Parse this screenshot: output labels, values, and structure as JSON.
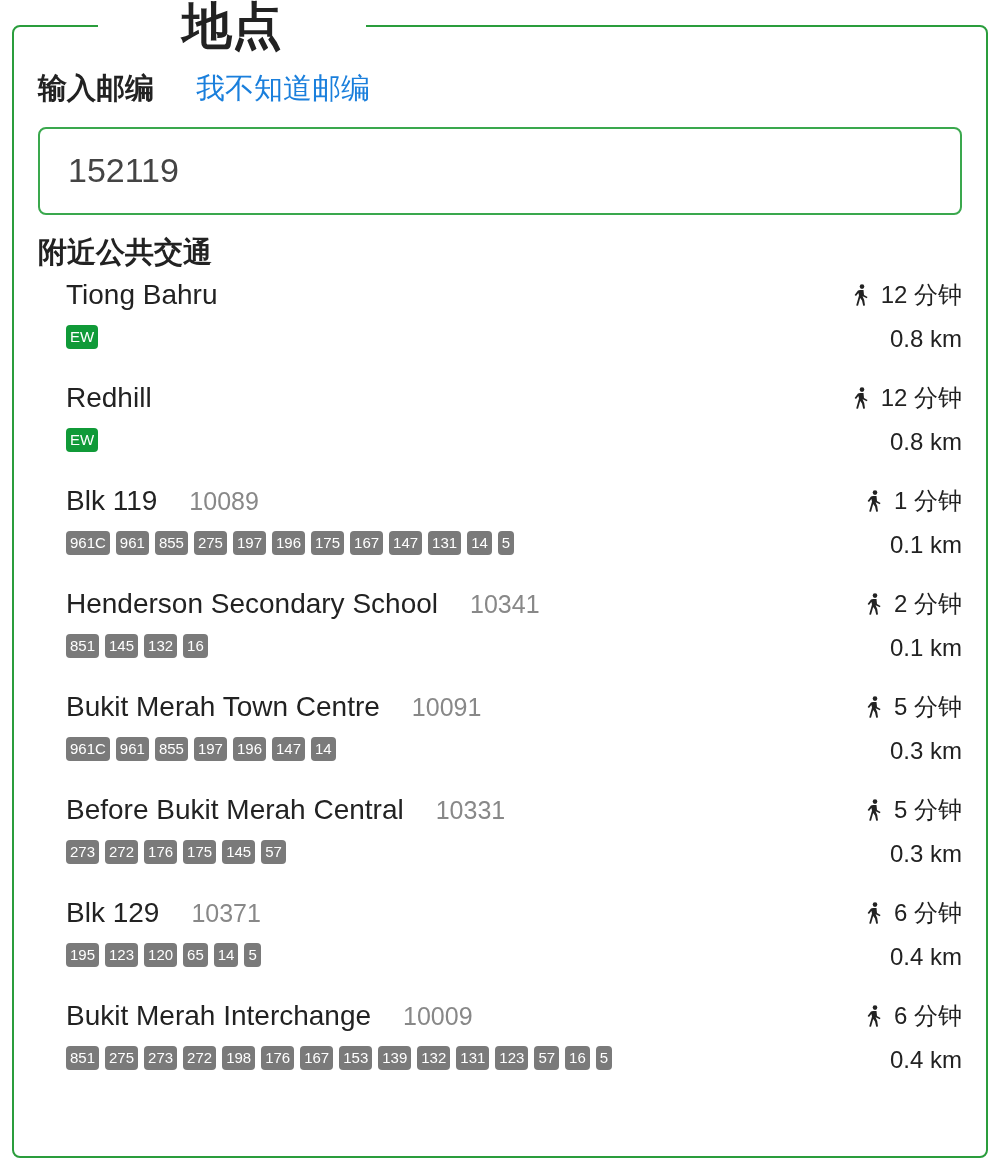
{
  "section": {
    "title": "地点"
  },
  "postal": {
    "label": "输入邮编",
    "link": "我不知道邮编",
    "value": "152119"
  },
  "nearby": {
    "heading": "附近公共交通",
    "stops": [
      {
        "kind": "mrt",
        "name": "Tiong Bahru",
        "lines": [
          "EW"
        ],
        "walk": "12 分钟",
        "distance": "0.8 km"
      },
      {
        "kind": "mrt",
        "name": "Redhill",
        "lines": [
          "EW"
        ],
        "walk": "12 分钟",
        "distance": "0.8 km"
      },
      {
        "kind": "bus",
        "name": "Blk 119",
        "code": "10089",
        "lines": [
          "961C",
          "961",
          "855",
          "275",
          "197",
          "196",
          "175",
          "167",
          "147",
          "131",
          "14",
          "5"
        ],
        "walk": "1 分钟",
        "distance": "0.1 km"
      },
      {
        "kind": "bus",
        "name": "Henderson Secondary School",
        "code": "10341",
        "lines": [
          "851",
          "145",
          "132",
          "16"
        ],
        "walk": "2 分钟",
        "distance": "0.1 km"
      },
      {
        "kind": "bus",
        "name": "Bukit Merah Town Centre",
        "code": "10091",
        "lines": [
          "961C",
          "961",
          "855",
          "197",
          "196",
          "147",
          "14"
        ],
        "walk": "5 分钟",
        "distance": "0.3 km"
      },
      {
        "kind": "bus",
        "name": "Before Bukit Merah Central",
        "code": "10331",
        "lines": [
          "273",
          "272",
          "176",
          "175",
          "145",
          "57"
        ],
        "walk": "5 分钟",
        "distance": "0.3 km"
      },
      {
        "kind": "bus",
        "name": "Blk 129",
        "code": "10371",
        "lines": [
          "195",
          "123",
          "120",
          "65",
          "14",
          "5"
        ],
        "walk": "6 分钟",
        "distance": "0.4 km"
      },
      {
        "kind": "bus",
        "name": "Bukit Merah Interchange",
        "code": "10009",
        "lines": [
          "851",
          "275",
          "273",
          "272",
          "198",
          "176",
          "167",
          "153",
          "139",
          "132",
          "131",
          "123",
          "57",
          "16",
          "5"
        ],
        "walk": "6 分钟",
        "distance": "0.4 km"
      }
    ]
  }
}
